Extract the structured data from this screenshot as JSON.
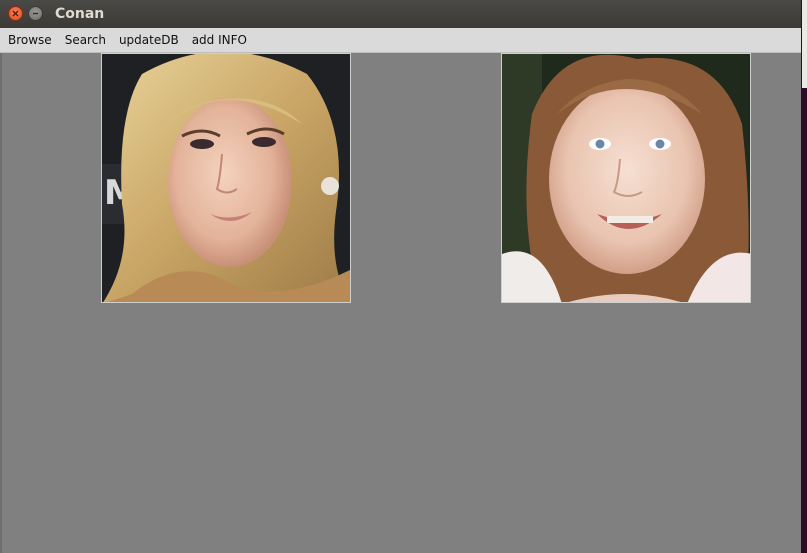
{
  "window": {
    "title": "Conan"
  },
  "menu": {
    "items": [
      "Browse",
      "Search",
      "updateDB",
      "add INFO"
    ]
  },
  "images": {
    "left": {
      "icon": "face-photo-icon"
    },
    "right": {
      "icon": "face-photo-icon"
    }
  },
  "colors": {
    "content_bg": "#808080",
    "menubar_bg": "#dadada",
    "titlebar_bg": "#3d3c38",
    "close_button": "#e9541f"
  }
}
